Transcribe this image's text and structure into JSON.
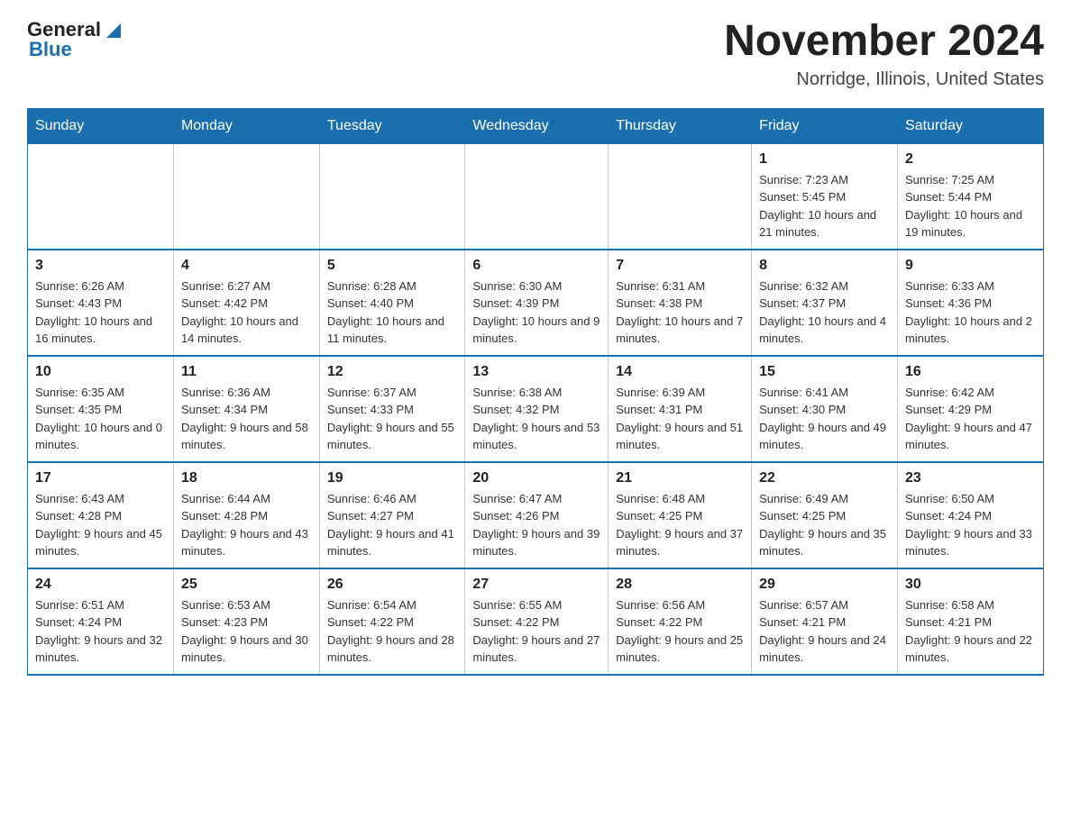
{
  "header": {
    "logo": {
      "general": "General",
      "blue": "Blue",
      "triangle_symbol": "▶"
    },
    "title": "November 2024",
    "location": "Norridge, Illinois, United States"
  },
  "calendar": {
    "days_of_week": [
      "Sunday",
      "Monday",
      "Tuesday",
      "Wednesday",
      "Thursday",
      "Friday",
      "Saturday"
    ],
    "weeks": [
      [
        {
          "day": "",
          "info": ""
        },
        {
          "day": "",
          "info": ""
        },
        {
          "day": "",
          "info": ""
        },
        {
          "day": "",
          "info": ""
        },
        {
          "day": "",
          "info": ""
        },
        {
          "day": "1",
          "info": "Sunrise: 7:23 AM\nSunset: 5:45 PM\nDaylight: 10 hours and 21 minutes."
        },
        {
          "day": "2",
          "info": "Sunrise: 7:25 AM\nSunset: 5:44 PM\nDaylight: 10 hours and 19 minutes."
        }
      ],
      [
        {
          "day": "3",
          "info": "Sunrise: 6:26 AM\nSunset: 4:43 PM\nDaylight: 10 hours and 16 minutes."
        },
        {
          "day": "4",
          "info": "Sunrise: 6:27 AM\nSunset: 4:42 PM\nDaylight: 10 hours and 14 minutes."
        },
        {
          "day": "5",
          "info": "Sunrise: 6:28 AM\nSunset: 4:40 PM\nDaylight: 10 hours and 11 minutes."
        },
        {
          "day": "6",
          "info": "Sunrise: 6:30 AM\nSunset: 4:39 PM\nDaylight: 10 hours and 9 minutes."
        },
        {
          "day": "7",
          "info": "Sunrise: 6:31 AM\nSunset: 4:38 PM\nDaylight: 10 hours and 7 minutes."
        },
        {
          "day": "8",
          "info": "Sunrise: 6:32 AM\nSunset: 4:37 PM\nDaylight: 10 hours and 4 minutes."
        },
        {
          "day": "9",
          "info": "Sunrise: 6:33 AM\nSunset: 4:36 PM\nDaylight: 10 hours and 2 minutes."
        }
      ],
      [
        {
          "day": "10",
          "info": "Sunrise: 6:35 AM\nSunset: 4:35 PM\nDaylight: 10 hours and 0 minutes."
        },
        {
          "day": "11",
          "info": "Sunrise: 6:36 AM\nSunset: 4:34 PM\nDaylight: 9 hours and 58 minutes."
        },
        {
          "day": "12",
          "info": "Sunrise: 6:37 AM\nSunset: 4:33 PM\nDaylight: 9 hours and 55 minutes."
        },
        {
          "day": "13",
          "info": "Sunrise: 6:38 AM\nSunset: 4:32 PM\nDaylight: 9 hours and 53 minutes."
        },
        {
          "day": "14",
          "info": "Sunrise: 6:39 AM\nSunset: 4:31 PM\nDaylight: 9 hours and 51 minutes."
        },
        {
          "day": "15",
          "info": "Sunrise: 6:41 AM\nSunset: 4:30 PM\nDaylight: 9 hours and 49 minutes."
        },
        {
          "day": "16",
          "info": "Sunrise: 6:42 AM\nSunset: 4:29 PM\nDaylight: 9 hours and 47 minutes."
        }
      ],
      [
        {
          "day": "17",
          "info": "Sunrise: 6:43 AM\nSunset: 4:28 PM\nDaylight: 9 hours and 45 minutes."
        },
        {
          "day": "18",
          "info": "Sunrise: 6:44 AM\nSunset: 4:28 PM\nDaylight: 9 hours and 43 minutes."
        },
        {
          "day": "19",
          "info": "Sunrise: 6:46 AM\nSunset: 4:27 PM\nDaylight: 9 hours and 41 minutes."
        },
        {
          "day": "20",
          "info": "Sunrise: 6:47 AM\nSunset: 4:26 PM\nDaylight: 9 hours and 39 minutes."
        },
        {
          "day": "21",
          "info": "Sunrise: 6:48 AM\nSunset: 4:25 PM\nDaylight: 9 hours and 37 minutes."
        },
        {
          "day": "22",
          "info": "Sunrise: 6:49 AM\nSunset: 4:25 PM\nDaylight: 9 hours and 35 minutes."
        },
        {
          "day": "23",
          "info": "Sunrise: 6:50 AM\nSunset: 4:24 PM\nDaylight: 9 hours and 33 minutes."
        }
      ],
      [
        {
          "day": "24",
          "info": "Sunrise: 6:51 AM\nSunset: 4:24 PM\nDaylight: 9 hours and 32 minutes."
        },
        {
          "day": "25",
          "info": "Sunrise: 6:53 AM\nSunset: 4:23 PM\nDaylight: 9 hours and 30 minutes."
        },
        {
          "day": "26",
          "info": "Sunrise: 6:54 AM\nSunset: 4:22 PM\nDaylight: 9 hours and 28 minutes."
        },
        {
          "day": "27",
          "info": "Sunrise: 6:55 AM\nSunset: 4:22 PM\nDaylight: 9 hours and 27 minutes."
        },
        {
          "day": "28",
          "info": "Sunrise: 6:56 AM\nSunset: 4:22 PM\nDaylight: 9 hours and 25 minutes."
        },
        {
          "day": "29",
          "info": "Sunrise: 6:57 AM\nSunset: 4:21 PM\nDaylight: 9 hours and 24 minutes."
        },
        {
          "day": "30",
          "info": "Sunrise: 6:58 AM\nSunset: 4:21 PM\nDaylight: 9 hours and 22 minutes."
        }
      ]
    ]
  }
}
